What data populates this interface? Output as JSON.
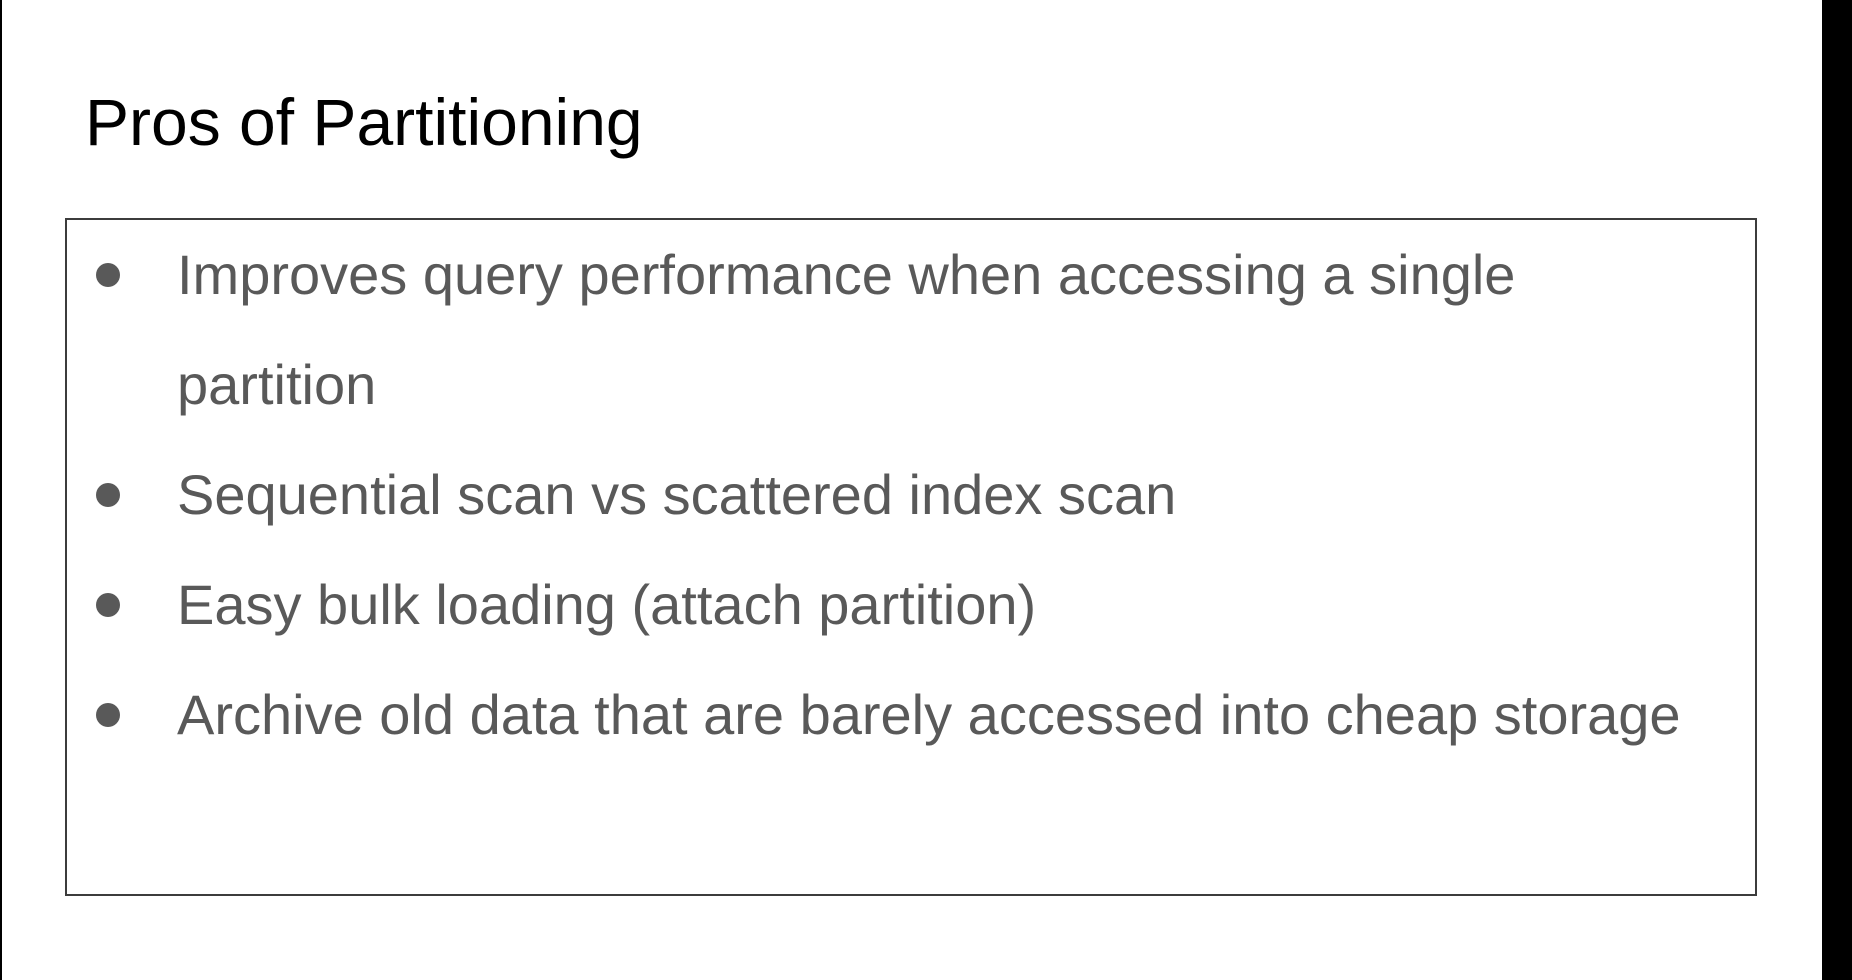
{
  "slide": {
    "title": "Pros of Partitioning",
    "bullets": [
      {
        "text": "Improves query performance when accessing a single partition"
      },
      {
        "text": "Sequential scan vs scattered index scan"
      },
      {
        "text": "Easy bulk loading (attach partition)"
      },
      {
        "text": "Archive old data that are barely accessed into cheap storage"
      }
    ]
  },
  "colors": {
    "background": "#ffffff",
    "title_text": "#000000",
    "body_text": "#595959",
    "frame": "#000000"
  }
}
